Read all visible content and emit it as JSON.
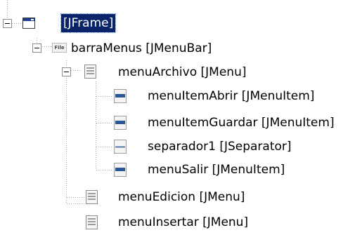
{
  "tree": {
    "root": {
      "label": "[JFrame]",
      "selected": true,
      "icon": "window-icon",
      "expanded": true
    },
    "menubar": {
      "label": "barraMenus [JMenuBar]",
      "icon": "menubar-icon",
      "icon_text": "File",
      "expanded": true
    },
    "menus": [
      {
        "label": "menuArchivo [JMenu]",
        "icon": "menu-icon",
        "expanded": true,
        "children": [
          {
            "label": "menuItemAbrir [JMenuItem]",
            "icon": "menu-item-icon"
          },
          {
            "label": "menuItemGuardar [JMenuItem]",
            "icon": "menu-item-icon"
          },
          {
            "label": "separador1 [JSeparator]",
            "icon": "separator-icon"
          },
          {
            "label": "menuSalir [JMenuItem]",
            "icon": "menu-item-icon"
          }
        ]
      },
      {
        "label": "menuEdicion [JMenu]",
        "icon": "menu-icon",
        "expanded": false
      },
      {
        "label": "menuInsertar [JMenu]",
        "icon": "menu-icon",
        "expanded": false
      }
    ]
  },
  "colors": {
    "selection": "#0a246a",
    "selection_text": "#ffffff",
    "tree_lines": "#a0a0a0",
    "icon_blue": "#2b5797"
  }
}
